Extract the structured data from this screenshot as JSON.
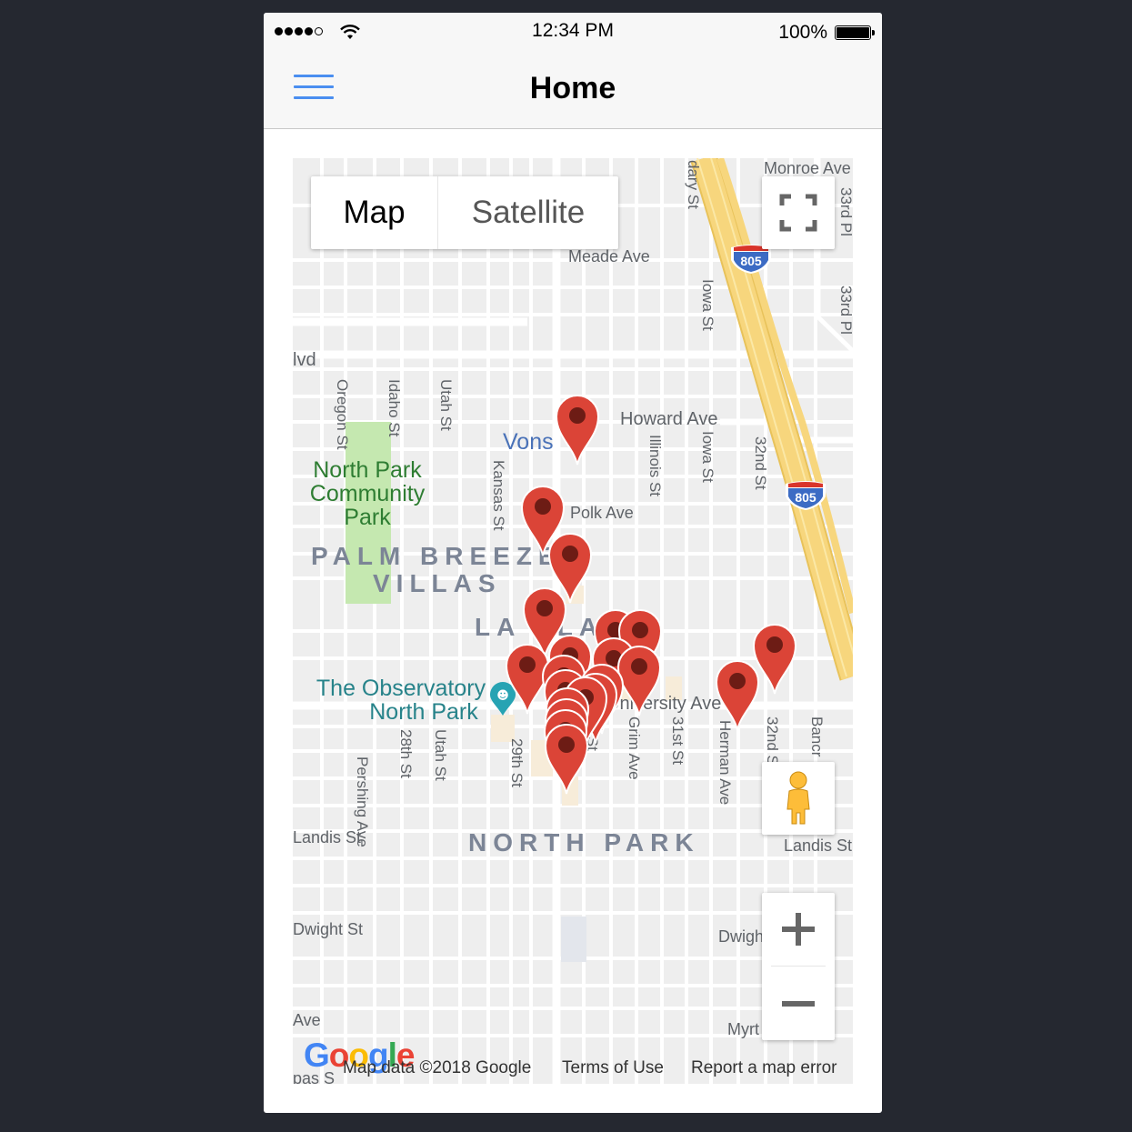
{
  "status_bar": {
    "time": "12:34 PM",
    "battery": "100%"
  },
  "nav": {
    "title": "Home"
  },
  "map": {
    "map_type": {
      "map": "Map",
      "satellite": "Satellite"
    },
    "streets": {
      "monroe": "Monroe Ave",
      "meade": "Meade Ave",
      "howard": "Howard Ave",
      "polk": "Polk Ave",
      "university": "University Ave",
      "landis_left": "Landis St",
      "landis_right": "Landis St",
      "dwight_left": "Dwight St",
      "dwight_right": "Dwigh",
      "myrtle": "Myrt",
      "blvd": "lvd",
      "ave_left": "Ave",
      "pas_left": "pas S",
      "oregon": "Oregon St",
      "idaho": "Idaho St",
      "utah_top": "Utah St",
      "kansas": "Kansas St",
      "illinois": "Illinois St",
      "iowa_top": "Iowa St",
      "iowa_mid": "Iowa St",
      "thirtysecond_top": "32nd St",
      "thirtythird_a": "33rd Pl",
      "thirtythird_b": "33rd Pl",
      "boundary": "dary St",
      "pershing": "Pershing Ave",
      "twentyeighth": "28th St",
      "utah_bottom": "Utah St",
      "twentyninth": "29th St",
      "thirtieth": "30th St",
      "grim": "Grim Ave",
      "thirtyfirst": "31st St",
      "herman": "Herman Ave",
      "thirtysecond_bottom": "32nd St",
      "bancroft": "Bancr"
    },
    "highway_shield": "805",
    "areas": {
      "palm_breeze": "PALM BREEZE",
      "villas": "VILLAS",
      "la_playa": "LA PLAYA",
      "north_park": "NORTH PARK"
    },
    "places": {
      "park_line1": "North Park",
      "park_line2": "Community",
      "park_line3": "Park",
      "vons": "Vons",
      "obs_line1": "The Observatory",
      "obs_line2": "North Park"
    },
    "marker_count": 21,
    "attribution": {
      "logo": "Google",
      "data": "Map data ©2018 Google",
      "terms": "Terms of Use",
      "report": "Report a map error"
    }
  },
  "icons": {
    "menu": "hamburger-menu-icon",
    "fullscreen": "fullscreen-icon",
    "pegman": "street-view-pegman-icon",
    "zoom_in": "plus-icon",
    "zoom_out": "minus-icon",
    "marker": "map-marker-icon"
  },
  "colors": {
    "accent": "#4a8ef0",
    "marker": "#db4437",
    "park": "#c5e8b0",
    "highway": "#f7d67d"
  }
}
